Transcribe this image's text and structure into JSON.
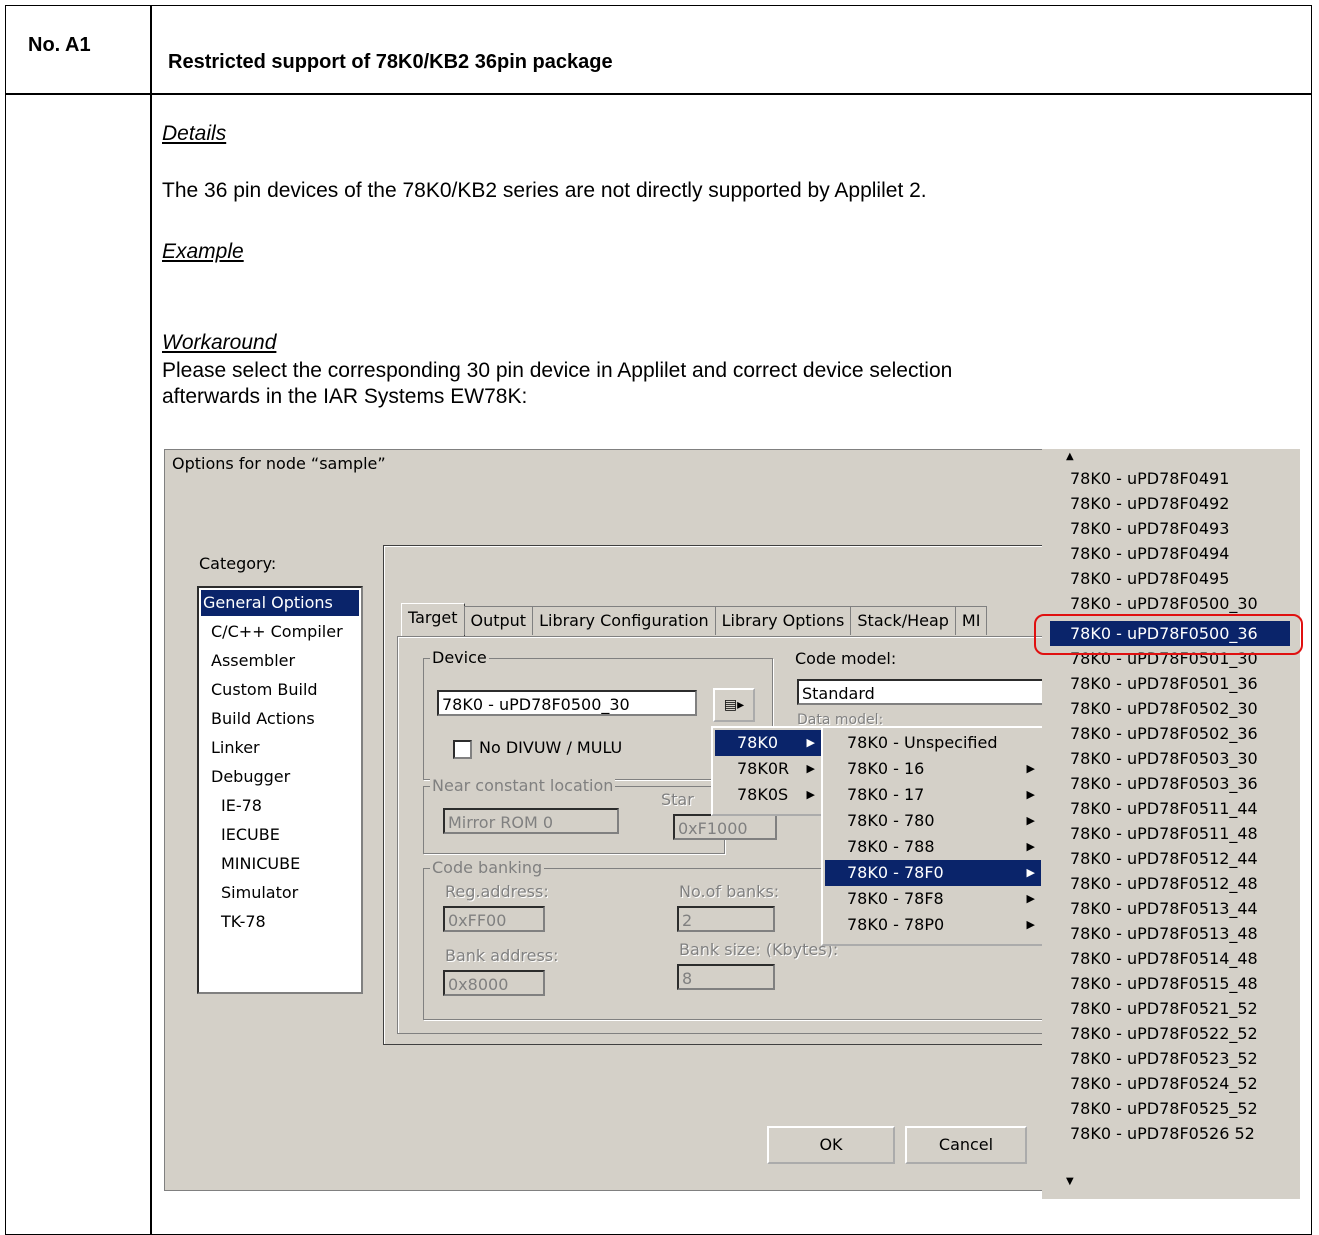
{
  "doc": {
    "number": "No. A1",
    "title": "Restricted support of 78K0/KB2 36pin package",
    "details_heading": "Details",
    "details_text": "The 36 pin devices of the 78K0/KB2 series are not directly supported by Applilet 2.",
    "example_heading": "Example",
    "workaround_heading": "Workaround",
    "workaround_line1": "Please select the corresponding 30 pin device in Applilet and correct device selection",
    "workaround_line2": "afterwards in the IAR Systems EW78K:"
  },
  "dialog": {
    "title": "Options for node “sample”",
    "category_label": "Category:",
    "categories": [
      "General Options",
      "C/C++ Compiler",
      "Assembler",
      "Custom Build",
      "Build Actions",
      "Linker",
      "Debugger",
      "IE-78",
      "IECUBE",
      "MINICUBE",
      "Simulator",
      "TK-78"
    ],
    "tabs": [
      "Target",
      "Output",
      "Library Configuration",
      "Library Options",
      "Stack/Heap",
      "MI"
    ],
    "device_group": "Device",
    "device_value": "78K0 - uPD78F0500_30",
    "no_divuw": "No DIVUW / MULU",
    "code_model_label": "Code model:",
    "code_model_value": "Standard",
    "data_model_label": "Data model:",
    "near_const_group": "Near constant location",
    "near_const_value": "Mirror ROM 0",
    "start_label": "Star",
    "start_value": "0xF1000",
    "code_banking_group": "Code banking",
    "reg_address_label": "Reg.address:",
    "reg_address_value": "0xFF00",
    "banks_label": "No.of banks:",
    "banks_value": "2",
    "bank_address_label": "Bank address:",
    "bank_address_value": "0x8000",
    "bank_size_label": "Bank size: (Kbytes):",
    "bank_size_value": "8",
    "ok": "OK",
    "cancel": "Cancel"
  },
  "menu1": [
    "78K0",
    "78K0R",
    "78K0S"
  ],
  "menu2": [
    "78K0 - Unspecified",
    "78K0 - 16",
    "78K0 - 17",
    "78K0 - 780",
    "78K0 - 788",
    "78K0 - 78F0",
    "78K0 - 78F8",
    "78K0 - 78P0"
  ],
  "devices": [
    "78K0 - uPD78F0491",
    "78K0 - uPD78F0492",
    "78K0 - uPD78F0493",
    "78K0 - uPD78F0494",
    "78K0 - uPD78F0495",
    "78K0 - uPD78F0500_30",
    "78K0 - uPD78F0500_36",
    "78K0 - uPD78F0501_30",
    "78K0 - uPD78F0501_36",
    "78K0 - uPD78F0502_30",
    "78K0 - uPD78F0502_36",
    "78K0 - uPD78F0503_30",
    "78K0 - uPD78F0503_36",
    "78K0 - uPD78F0511_44",
    "78K0 - uPD78F0511_48",
    "78K0 - uPD78F0512_44",
    "78K0 - uPD78F0512_48",
    "78K0 - uPD78F0513_44",
    "78K0 - uPD78F0513_48",
    "78K0 - uPD78F0514_48",
    "78K0 - uPD78F0515_48",
    "78K0 - uPD78F0521_52",
    "78K0 - uPD78F0522_52",
    "78K0 - uPD78F0523_52",
    "78K0 - uPD78F0524_52",
    "78K0 - uPD78F0525_52",
    "78K0 - uPD78F0526 52"
  ]
}
